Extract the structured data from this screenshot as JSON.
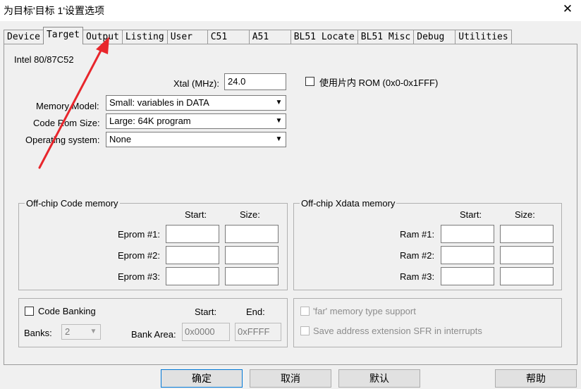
{
  "window": {
    "title": "为目标'目标 1'设置选项",
    "close_glyph": "✕"
  },
  "tabs": [
    "Device",
    "Target",
    "Output",
    "Listing",
    "User",
    "C51",
    "A51",
    "BL51 Locate",
    "BL51 Misc",
    "Debug",
    "Utilities"
  ],
  "active_tab": "Target",
  "target": {
    "device_name": "Intel 80/87C52",
    "xtal_label": "Xtal (MHz):",
    "xtal_value": "24.0",
    "onchip_rom_label": "使用片内 ROM (0x0-0x1FFF)",
    "memory_model_label": "Memory Model:",
    "memory_model_value": "Small: variables in DATA",
    "code_rom_label": "Code Rom Size:",
    "code_rom_value": "Large: 64K program",
    "os_label": "Operating system:",
    "os_value": "None"
  },
  "code_memory": {
    "title": "Off-chip Code memory",
    "start_label": "Start:",
    "size_label": "Size:",
    "rows": [
      "Eprom #1:",
      "Eprom #2:",
      "Eprom #3:"
    ]
  },
  "xdata_memory": {
    "title": "Off-chip Xdata memory",
    "start_label": "Start:",
    "size_label": "Size:",
    "rows": [
      "Ram #1:",
      "Ram #2:",
      "Ram #3:"
    ]
  },
  "banking": {
    "code_banking_label": "Code Banking",
    "start_label": "Start:",
    "end_label": "End:",
    "banks_label": "Banks:",
    "banks_value": "2",
    "bank_area_label": "Bank Area:",
    "bank_start": "0x0000",
    "bank_end": "0xFFFF"
  },
  "options": {
    "far_memory": "'far' memory type support",
    "save_sfr": "Save address extension SFR in interrupts"
  },
  "buttons": {
    "ok": "确定",
    "cancel": "取消",
    "defaults": "默认",
    "help": "帮助"
  },
  "annotation": {
    "arrow_color": "#e8262c"
  }
}
